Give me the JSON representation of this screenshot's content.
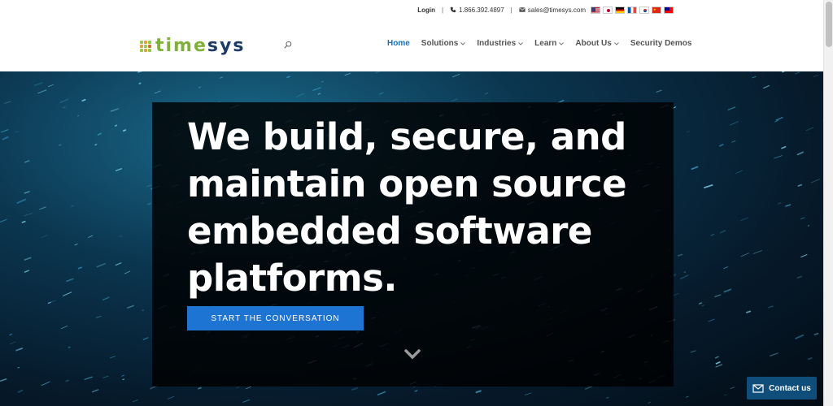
{
  "topbar": {
    "login": "Login",
    "separator": "|",
    "phone": "1.866.392.4897",
    "email": "sales@timesys.com",
    "flags": [
      "us-flag",
      "jp-flag",
      "de-flag",
      "fr-flag",
      "kr-flag",
      "cn-flag",
      "tw-flag"
    ]
  },
  "logo": {
    "part1": "time",
    "part2": "sys"
  },
  "nav": {
    "items": [
      {
        "label": "Home",
        "active": true
      },
      {
        "label": "Solutions",
        "dropdown": true
      },
      {
        "label": "Industries",
        "dropdown": true
      },
      {
        "label": "Learn",
        "dropdown": true
      },
      {
        "label": "About Us",
        "dropdown": true
      },
      {
        "label": "Security Demos"
      }
    ]
  },
  "hero": {
    "headline": "We build, secure, and maintain open source embedded software platforms.",
    "cta": "START THE CONVERSATION"
  },
  "contact": {
    "label": "Contact us"
  },
  "colors": {
    "accent": "#1a6fb7",
    "cta": "#1d74d2",
    "logo_green": "#7fb13a",
    "logo_navy": "#1d3b66",
    "contact_bg": "#0f4d7a"
  }
}
